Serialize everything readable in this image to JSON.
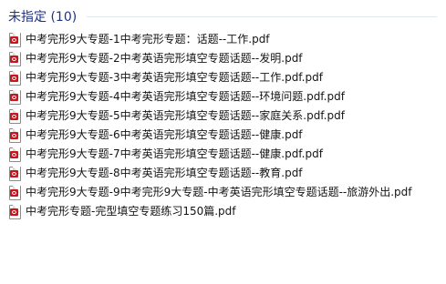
{
  "group": {
    "title": "未指定 (10)"
  },
  "files": [
    {
      "name": "中考完形9大专题-1中考完形专题：话题--工作.pdf",
      "icon": "pdf-file-icon"
    },
    {
      "name": "中考完形9大专题-2中考英语完形填空专题话题--发明.pdf",
      "icon": "pdf-file-icon"
    },
    {
      "name": "中考完形9大专题-3中考英语完形填空专题话题--工作.pdf.pdf",
      "icon": "pdf-file-icon"
    },
    {
      "name": "中考完形9大专题-4中考英语完形填空专题话题--环境问题.pdf.pdf",
      "icon": "pdf-file-icon"
    },
    {
      "name": "中考完形9大专题-5中考英语完形填空专题话题--家庭关系.pdf.pdf",
      "icon": "pdf-file-icon"
    },
    {
      "name": "中考完形9大专题-6中考英语完形填空专题话题--健康.pdf",
      "icon": "pdf-file-icon"
    },
    {
      "name": "中考完形9大专题-7中考英语完形填空专题话题--健康.pdf.pdf",
      "icon": "pdf-file-icon"
    },
    {
      "name": "中考完形9大专题-8中考英语完形填空专题话题--教育.pdf",
      "icon": "pdf-file-icon"
    },
    {
      "name": "中考完形9大专题-9中考完形9大专题-中考英语完形填空专题话题--旅游外出.pdf",
      "icon": "pdf-file-icon"
    },
    {
      "name": "中考完形专题-完型填空专题练习150篇.pdf",
      "icon": "pdf-file-icon"
    }
  ],
  "colors": {
    "group_title": "#1e3287",
    "divider": "#e2e7f0",
    "pdf_badge": "#c8161d",
    "file_text": "#141414"
  }
}
